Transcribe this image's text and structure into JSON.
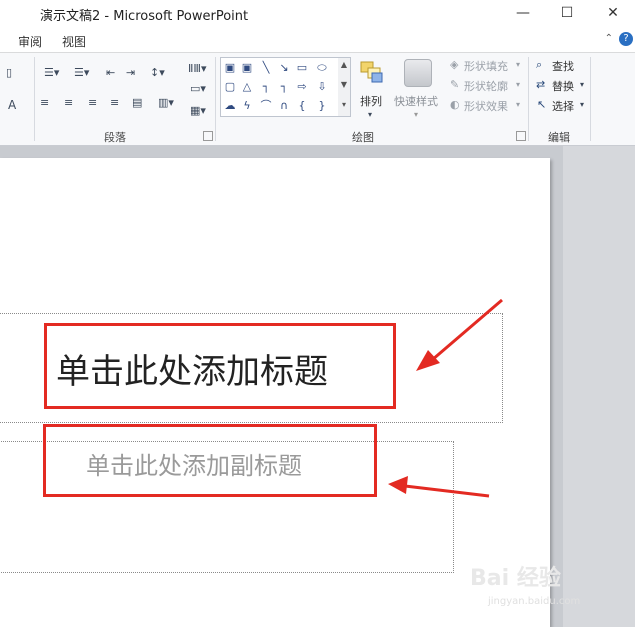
{
  "window": {
    "title": "演示文稿2 - Microsoft PowerPoint",
    "minimize": "—",
    "maximize": "☐",
    "close": "✕"
  },
  "menu": {
    "items": [
      "审阅",
      "视图"
    ],
    "help": "?",
    "collapse": "⌃"
  },
  "ribbon": {
    "groups": {
      "paragraph": "段落",
      "drawing": "绘图",
      "editing": "编辑"
    },
    "drawing": {
      "arrange_label": "排列",
      "quick_styles_label": "快速样式",
      "shape_fill": "形状填充",
      "shape_outline": "形状轮廓",
      "shape_effects": "形状效果"
    },
    "editing": {
      "find": "查找",
      "replace": "替换",
      "select": "选择"
    },
    "font_a": "A"
  },
  "slide": {
    "title_placeholder": "单击此处添加标题",
    "subtitle_placeholder": "单击此处添加副标题"
  },
  "watermark": {
    "main": "Bai 经验",
    "sub": "jingyan.baidu.com"
  },
  "colors": {
    "accent_red": "#e32a22",
    "help_blue": "#2a6fc2"
  }
}
